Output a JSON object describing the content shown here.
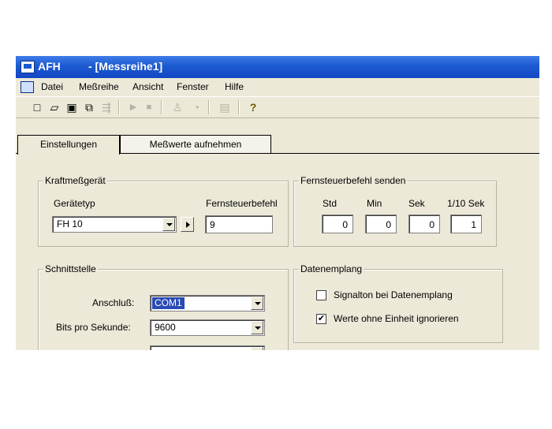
{
  "title": {
    "app": "AFH",
    "document": "- [Messreihe1]"
  },
  "menu": [
    "Datei",
    "Meßreihe",
    "Ansicht",
    "Fenster",
    "Hilfe"
  ],
  "toolbar_icons": [
    {
      "name": "new-file-icon",
      "glyph": "🗋",
      "enabled": true
    },
    {
      "name": "open-folder-icon",
      "glyph": "📂",
      "enabled": true
    },
    {
      "name": "save-icon",
      "glyph": "💾",
      "enabled": true
    },
    {
      "name": "copy-icon",
      "glyph": "⧉",
      "enabled": true
    },
    {
      "name": "export-icon",
      "glyph": "⇶",
      "enabled": false
    },
    {
      "name": "play-icon",
      "glyph": "▶",
      "enabled": false
    },
    {
      "name": "stop-icon",
      "glyph": "■",
      "enabled": false
    },
    {
      "name": "weight-icon",
      "glyph": "⚖",
      "enabled": false
    },
    {
      "name": "timer-icon",
      "glyph": "◔",
      "enabled": false
    },
    {
      "name": "table-icon",
      "glyph": "▤",
      "enabled": false
    },
    {
      "name": "help-icon",
      "glyph": "?",
      "enabled": true
    }
  ],
  "tabs": {
    "settings": "Einstellungen",
    "measure": "Meßwerte aufnehmen"
  },
  "device_group": {
    "title": "Kraftmeßgerät",
    "type_label": "Gerätetyp",
    "type_value": "FH 10",
    "remote_label": "Fernsteuerbefehl",
    "remote_value": "9"
  },
  "remote_group": {
    "title": "Fernsteuerbefehl senden",
    "std_label": "Std",
    "std_value": "0",
    "min_label": "Min",
    "min_value": "0",
    "sek_label": "Sek",
    "sek_value": "0",
    "tenth_label": "1/10 Sek",
    "tenth_value": "1"
  },
  "interface_group": {
    "title": "Schnittstelle",
    "port_label": "Anschluß:",
    "port_value": "COM1",
    "baud_label": "Bits pro Sekunde:",
    "baud_value": "9600"
  },
  "data_group": {
    "title": "Datenemplang",
    "signal_label": "Signalton bei Datenemplang",
    "signal_checked": false,
    "ignore_unit_label": "Werte ohne Einheit ignorieren",
    "ignore_unit_checked": true
  },
  "colors": {
    "titlebar": "#1b5ad0",
    "face": "#ece9d8",
    "selection": "#2a4bb5"
  }
}
